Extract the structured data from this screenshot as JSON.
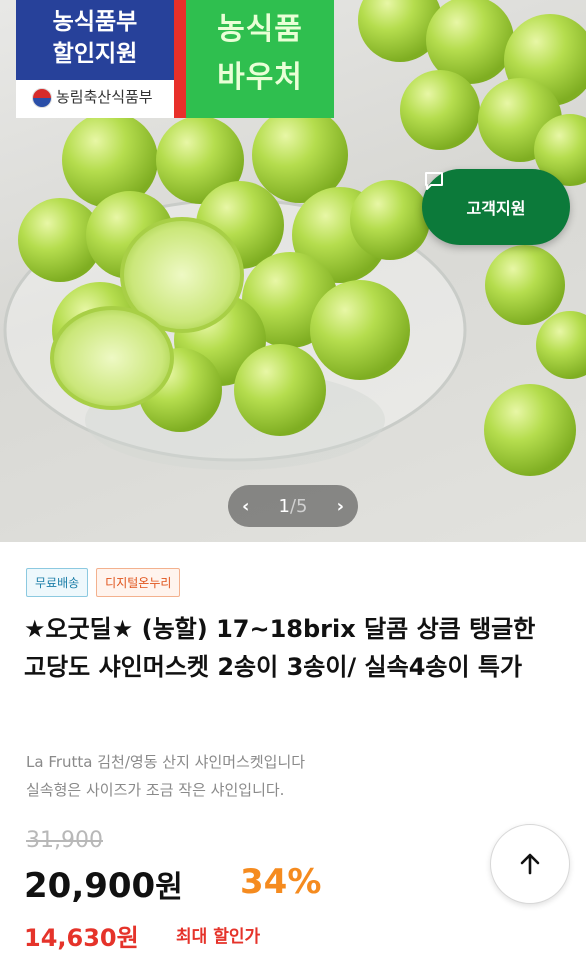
{
  "image": {
    "badge_blue_line1": "농식품부",
    "badge_blue_line2": "할인지원",
    "ministry": "농림축산식품부",
    "badge_green_line1": "농식품",
    "badge_green_line2": "바우처"
  },
  "support_button": {
    "label": "고객지원",
    "icon": "chat-icon"
  },
  "pager": {
    "current": "1",
    "separator": "/",
    "total": "5",
    "prev_icon": "chevron-left-icon",
    "next_icon": "chevron-right-icon"
  },
  "tags": [
    "무료배송",
    "디지털온누리"
  ],
  "product": {
    "title": "★오굿딜★ (농할) 17~18brix 달콤 상큼 탱글한 고당도 샤인머스켓 2송이 3송이/ 실속4송이 특가",
    "desc_line1": "La Frutta 김천/영동 산지 샤인머스켓입니다",
    "desc_line2": "실속형은 사이즈가 조금 작은 샤인입니다."
  },
  "price": {
    "original": "31,900",
    "sale": "20,900",
    "won": "원",
    "discount": "34%",
    "max_discount_price": "14,630원",
    "max_discount_label": "최대 할인가"
  },
  "scroll_top": {
    "icon": "arrow-up-icon"
  },
  "colors": {
    "support_green": "#0c7a3a",
    "discount_orange": "#f58b1f",
    "max_red": "#e5332a"
  }
}
